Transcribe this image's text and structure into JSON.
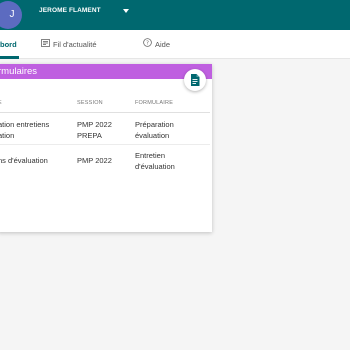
{
  "header": {
    "avatar_initial": "J",
    "username": "JEROME FLAMENT",
    "accent_color": "#00686f"
  },
  "tabs": [
    {
      "label": "bord",
      "icon": "dashboard-icon",
      "active": true
    },
    {
      "label": "Fil d'actualité",
      "icon": "newsfeed-icon",
      "active": false
    },
    {
      "label": "Aide",
      "icon": "help-icon",
      "active": false
    }
  ],
  "card": {
    "title": "rmulaires",
    "header_color": "#bf5fe0",
    "action_icon": "document-icon",
    "columns": [
      "E",
      "SESSION",
      "FORMULAIRE"
    ],
    "rows": [
      {
        "name": "ation entretiens\nation",
        "session": "PMP 2022\nPREPA",
        "form": "Préparation\névaluation"
      },
      {
        "name": "ns d'évaluation",
        "session": "PMP 2022",
        "form": "Entretien\nd'évaluation"
      }
    ]
  }
}
